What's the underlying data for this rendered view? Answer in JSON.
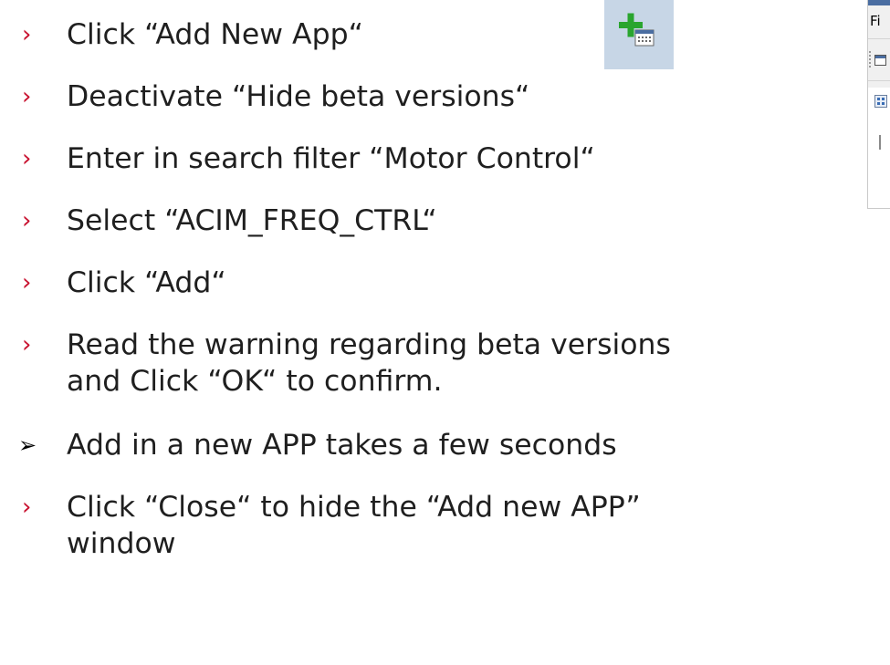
{
  "instructions": [
    {
      "marker": "›",
      "lines": [
        "Click “Add New App“"
      ]
    },
    {
      "marker": "›",
      "lines": [
        "Deactivate “Hide beta versions“"
      ]
    },
    {
      "marker": "›",
      "lines": [
        "Enter in search filter “Motor Control“"
      ]
    },
    {
      "marker": "›",
      "lines": [
        "Select “ACIM_FREQ_CTRL“"
      ]
    },
    {
      "marker": "›",
      "lines": [
        "Click “Add“"
      ]
    },
    {
      "marker": "›",
      "lines": [
        "Read the warning regarding beta versions",
        "and Click “OK“ to confirm."
      ]
    },
    {
      "marker": "➢",
      "lines": [
        "Add in a new APP takes a few seconds"
      ]
    },
    {
      "marker": "›",
      "lines": [
        "Click “Close“ to hide the “Add new APP”",
        "window"
      ]
    }
  ],
  "add_app_icon": {
    "name": "add-new-app-icon",
    "plus_color": "#2aa52f",
    "background": "#c7d6e6"
  },
  "thumbnail": {
    "menu_fragment": "Fi"
  },
  "colors": {
    "bullet": "#c8102e",
    "text": "#1f1f1f",
    "arrow": "#000000"
  }
}
